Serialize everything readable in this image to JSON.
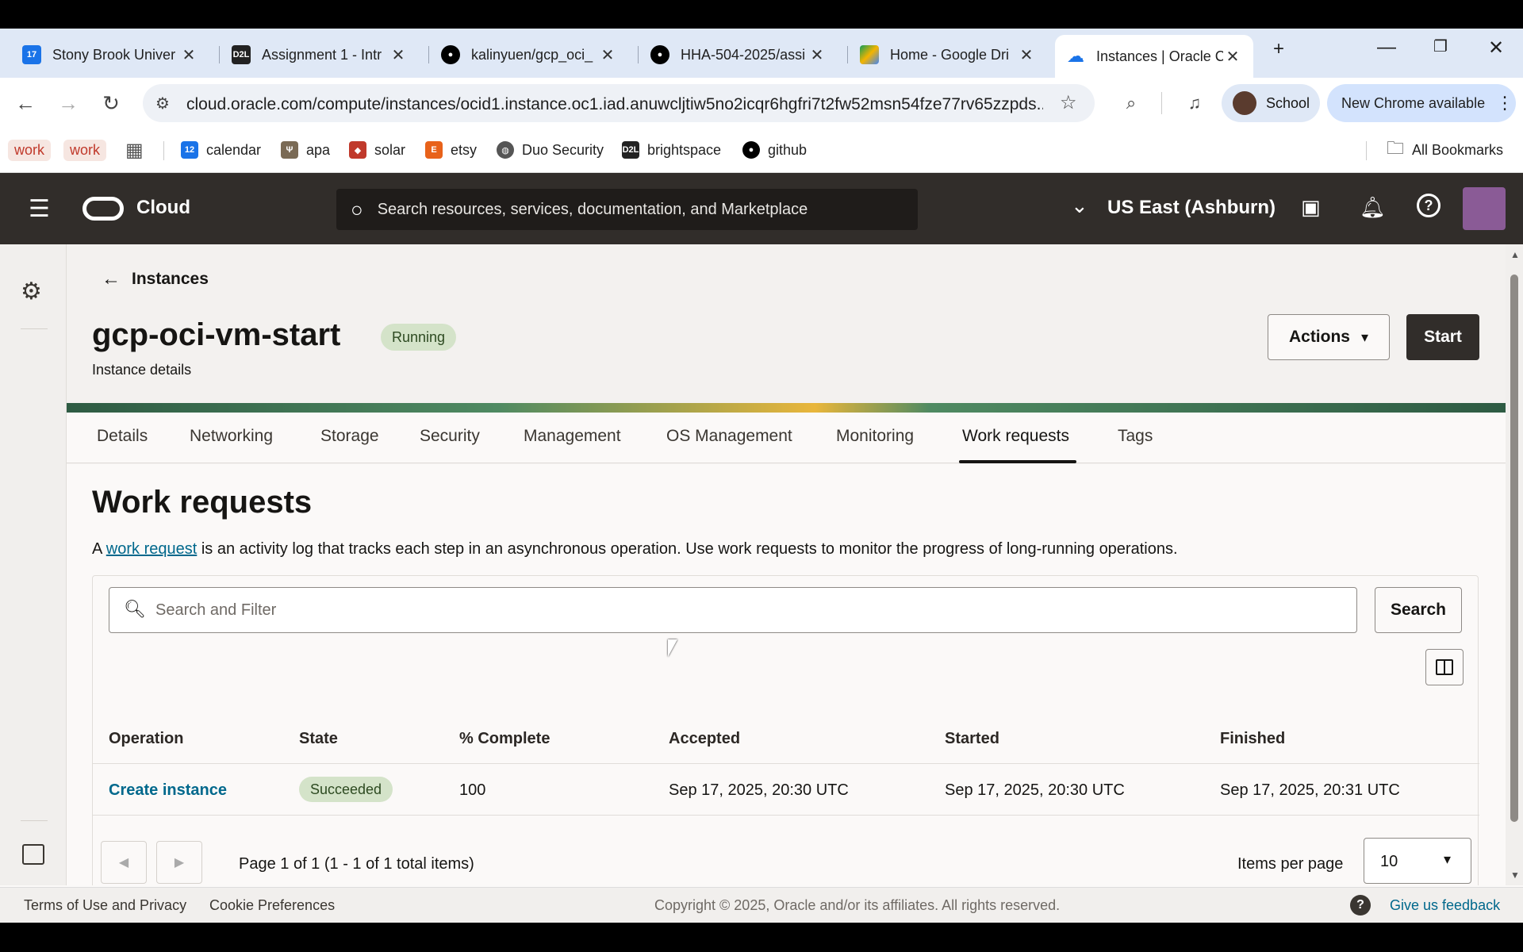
{
  "browser": {
    "tabs": [
      {
        "title": "Stony Brook Univer",
        "favicon": "calendar-icon",
        "color": "#1a73e8"
      },
      {
        "title": "Assignment 1 - Intr",
        "favicon": "d2l-icon",
        "color": "#222222"
      },
      {
        "title": "kalinyuen/gcp_oci_",
        "favicon": "github-icon",
        "color": "#000000"
      },
      {
        "title": "HHA-504-2025/assi",
        "favicon": "github-icon",
        "color": "#000000"
      },
      {
        "title": "Home - Google Dri",
        "favicon": "google-drive-icon",
        "color": "#0f9d58"
      },
      {
        "title": "Instances | Oracle C",
        "favicon": "cloud-icon",
        "color": "#1a73e8"
      }
    ],
    "url": "cloud.oracle.com/compute/instances/ocid1.instance.oc1.iad.anuwcljtiw5no2icqr6hgfri7t2fw52msn54fze77rv65zzpds...",
    "profile_label": "School",
    "new_chrome_label": "New Chrome available",
    "bookmarks": [
      {
        "label": "work",
        "type": "chip"
      },
      {
        "label": "work",
        "type": "chip"
      },
      {
        "label": "calendar",
        "icon": "calendar-icon"
      },
      {
        "label": "apa",
        "icon": "apa-icon"
      },
      {
        "label": "solar",
        "icon": "shield-icon"
      },
      {
        "label": "etsy",
        "icon": "etsy-icon"
      },
      {
        "label": "Duo Security",
        "icon": "globe-icon"
      },
      {
        "label": "brightspace",
        "icon": "d2l-icon"
      },
      {
        "label": "github",
        "icon": "github-icon"
      }
    ],
    "all_bookmarks_label": "All Bookmarks"
  },
  "oci": {
    "brand": "Cloud",
    "search_placeholder": "Search resources, services, documentation, and Marketplace",
    "region": "US East (Ashburn)"
  },
  "instance": {
    "back_label": "Instances",
    "name": "gcp-oci-vm-start",
    "status": "Running",
    "subtitle": "Instance details",
    "actions_label": "Actions",
    "start_label": "Start"
  },
  "page_tabs": [
    "Details",
    "Networking",
    "Storage",
    "Security",
    "Management",
    "OS Management",
    "Monitoring",
    "Work requests",
    "Tags"
  ],
  "active_tab": "Work requests",
  "work_requests": {
    "heading": "Work requests",
    "desc_prefix": "A ",
    "desc_link": "work request",
    "desc_suffix": " is an activity log that tracks each step in an asynchronous operation. Use work requests to monitor the progress of long-running operations.",
    "search_placeholder": "Search and Filter",
    "search_button": "Search",
    "columns": [
      "Operation",
      "State",
      "% Complete",
      "Accepted",
      "Started",
      "Finished"
    ],
    "rows": [
      {
        "operation": "Create instance",
        "state": "Succeeded",
        "complete": "100",
        "accepted": "Sep 17, 2025, 20:30 UTC",
        "started": "Sep 17, 2025, 20:30 UTC",
        "finished": "Sep 17, 2025, 20:31 UTC"
      }
    ],
    "pagination": "Page 1 of 1 (1 - 1 of 1 total items)",
    "items_per_page_label": "Items per page",
    "items_per_page_value": "10"
  },
  "footer": {
    "terms": "Terms of Use and Privacy",
    "cookies": "Cookie Preferences",
    "copyright": "Copyright © 2025, Oracle and/or its affiliates. All rights reserved.",
    "feedback": "Give us feedback"
  },
  "colors": {
    "oci_header": "#312d2a",
    "running_badge": "#d4e3c9",
    "succeeded_badge": "#d4e3c9",
    "link": "#00688c"
  }
}
